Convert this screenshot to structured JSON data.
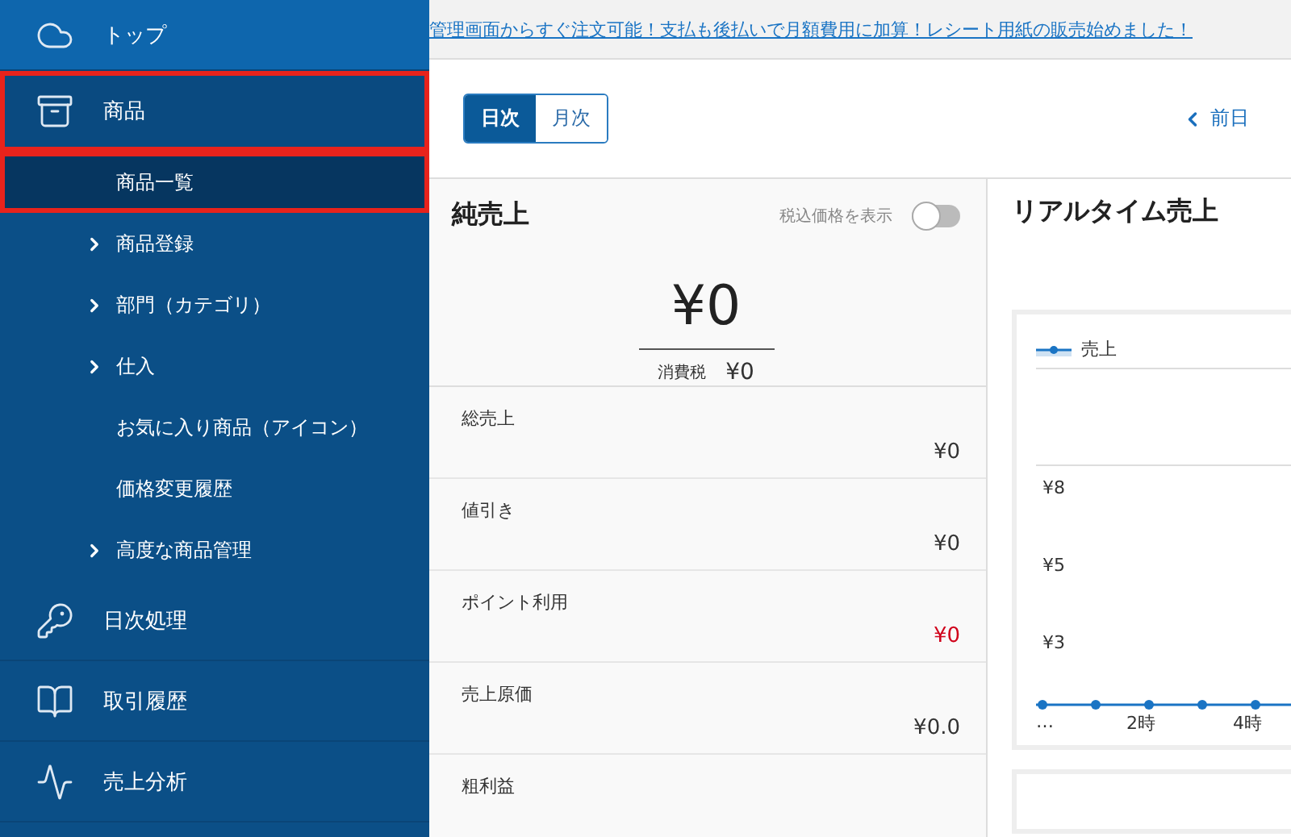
{
  "sidebar": {
    "items": [
      {
        "kind": "cloud",
        "label": "トップ",
        "highlighted": false
      },
      {
        "kind": "box",
        "label": "商品",
        "highlighted": true,
        "children": [
          {
            "label": "商品一覧",
            "selected": true,
            "expandable": false,
            "highlighted": true
          },
          {
            "label": "商品登録",
            "selected": false,
            "expandable": true,
            "highlighted": false
          },
          {
            "label": "部門（カテゴリ）",
            "selected": false,
            "expandable": true,
            "highlighted": false
          },
          {
            "label": "仕入",
            "selected": false,
            "expandable": true,
            "highlighted": false
          },
          {
            "label": "お気に入り商品（アイコン）",
            "selected": false,
            "expandable": false,
            "highlighted": false
          },
          {
            "label": "価格変更履歴",
            "selected": false,
            "expandable": false,
            "highlighted": false
          },
          {
            "label": "高度な商品管理",
            "selected": false,
            "expandable": true,
            "highlighted": false
          }
        ]
      },
      {
        "kind": "key",
        "label": "日次処理",
        "highlighted": false
      },
      {
        "kind": "book",
        "label": "取引履歴",
        "highlighted": false
      },
      {
        "kind": "trend",
        "label": "売上分析",
        "highlighted": false
      }
    ]
  },
  "banner": {
    "link": "管理画面からすぐ注文可能！支払も後払いで月額費用に加算！レシート用紙の販売始めました！"
  },
  "toolbar": {
    "tabs": [
      {
        "label": "日次",
        "selected": true
      },
      {
        "label": "月次",
        "selected": false
      }
    ],
    "prev_button": "前日"
  },
  "net_sales": {
    "title": "純売上",
    "toggle": {
      "label": "税込価格を表示",
      "on": false
    },
    "amount": "¥0",
    "tax_label": "消費税",
    "tax_value": "¥0",
    "rows": [
      {
        "label": "総売上",
        "value": "¥0",
        "alert": false
      },
      {
        "label": "値引き",
        "value": "¥0",
        "alert": false
      },
      {
        "label": "ポイント利用",
        "value": "¥0",
        "alert": true
      },
      {
        "label": "売上原価",
        "value": "¥0.0",
        "alert": false
      },
      {
        "label": "粗利益"
      }
    ]
  },
  "realtime": {
    "title": "リアルタイム売上",
    "legend": "売上",
    "y_labels": [
      "¥8",
      "¥5",
      "¥3"
    ],
    "x_labels": [
      "…",
      "2時",
      "4時"
    ]
  }
}
